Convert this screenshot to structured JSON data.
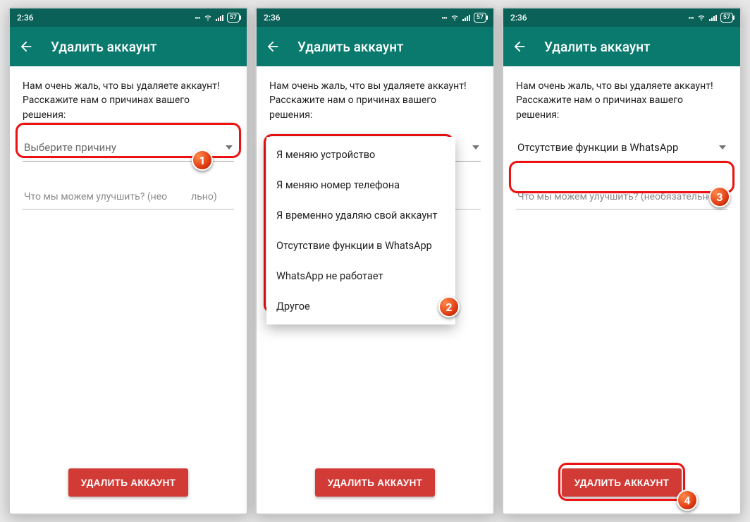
{
  "status": {
    "time": "2:36",
    "battery": "57"
  },
  "appbar": {
    "title": "Удалить аккаунт"
  },
  "prompt": "Нам очень жаль, что вы удаляете аккаунт! Расскажите нам о причинах вашего решения:",
  "dropdown": {
    "placeholder": "Выберите причину",
    "selected": "Отсутствие функции в WhatsApp",
    "options": [
      "Я меняю устройство",
      "Я меняю номер телефона",
      "Я временно удаляю свой аккаунт",
      "Отсутствие функции в WhatsApp",
      "WhatsApp не работает",
      "Другое"
    ]
  },
  "feedback_placeholder_full": "Что мы можем улучшить? (необязательно)",
  "feedback_placeholder_left": "Что мы можем улучшить? (нео",
  "feedback_placeholder_right": "льно)",
  "delete_label": "УДАЛИТЬ АККАУНТ",
  "badges": {
    "s1": "1",
    "s2": "2",
    "s3": "3",
    "s4": "4"
  }
}
